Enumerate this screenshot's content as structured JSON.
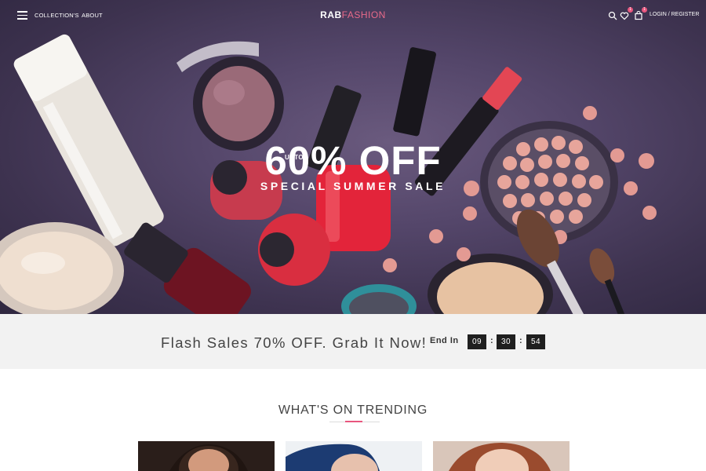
{
  "nav": {
    "left_links": [
      "COLLECTION'S",
      "ABOUT"
    ],
    "brand_primary": "RAB",
    "brand_secondary": "FASHION",
    "wishlist_count": "1",
    "cart_count": "1",
    "login_label": "LOGIN / REGISTER",
    "icons": [
      "menu-icon",
      "search-icon",
      "heart-icon",
      "cart-icon"
    ]
  },
  "hero": {
    "headline": "60% OFF",
    "upto": "UPTO",
    "subheadline": "SPECIAL SUMMER SALE"
  },
  "flash": {
    "text": "Flash Sales 70% OFF. Grab It Now!",
    "end_label": "End In",
    "timer": [
      "09",
      "30",
      "54"
    ],
    "separator": ":"
  },
  "trending": {
    "title": "WHAT'S ON TRENDING"
  },
  "colors": {
    "accent": "#e8567e",
    "timer_bg": "#1f1f1f",
    "flash_bg": "#f2f2f2"
  }
}
